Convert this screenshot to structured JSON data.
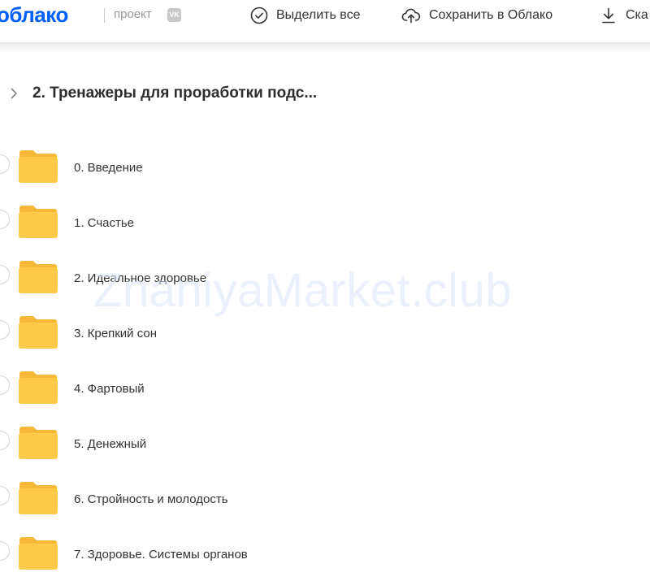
{
  "header": {
    "logo": "облако",
    "project_label": "проект",
    "vk_badge": "VK",
    "actions": {
      "select_all": "Выделить все",
      "save_to_cloud": "Сохранить в Облако",
      "download": "Ска"
    }
  },
  "breadcrumb": {
    "title": "2. Тренажеры для проработки подс..."
  },
  "folders": [
    {
      "name": "0. Введение"
    },
    {
      "name": "1. Счастье"
    },
    {
      "name": "2. Идеальное здоровье"
    },
    {
      "name": "3. Крепкий сон"
    },
    {
      "name": "4. Фартовый"
    },
    {
      "name": "5. Денежный"
    },
    {
      "name": "6. Стройность и молодость"
    },
    {
      "name": "7. Здоровье. Системы органов"
    }
  ],
  "watermark": "ZnaniyaMarket.club",
  "colors": {
    "brand": "#005ff9",
    "folder": "#ffc94a",
    "folder_tab": "#f9b938"
  }
}
